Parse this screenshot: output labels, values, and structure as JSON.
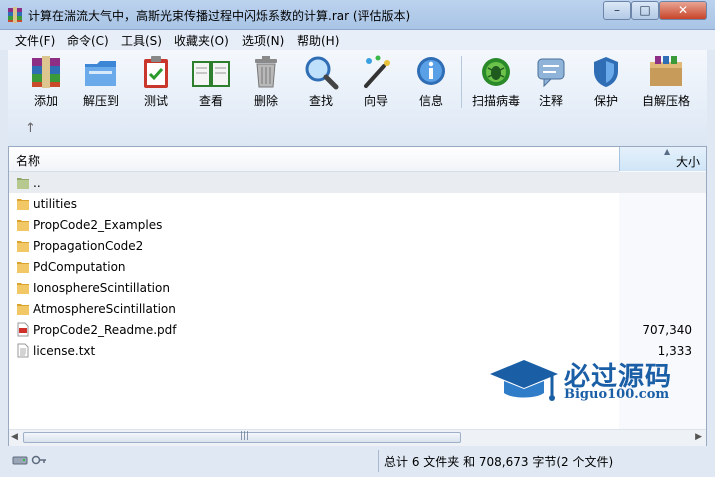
{
  "window": {
    "title": "计算在湍流大气中，高斯光束传播过程中闪烁系数的计算.rar (评估版本)",
    "min_glyph": "–",
    "max_glyph": "□",
    "close_glyph": "✕"
  },
  "menu": [
    "文件(F)",
    "命令(C)",
    "工具(S)",
    "收藏夹(O)",
    "选项(N)",
    "帮助(H)"
  ],
  "toolbar": {
    "buttons": [
      "添加",
      "解压到",
      "测试",
      "查看",
      "删除",
      "查找",
      "向导",
      "信息",
      "扫描病毒",
      "注释",
      "保护",
      "自解压格"
    ],
    "up_glyph": "↑"
  },
  "list": {
    "columns": {
      "name": "名称",
      "size": "大小"
    },
    "rows": [
      {
        "name": "..",
        "size": "",
        "type": "parent"
      },
      {
        "name": "utilities",
        "size": "",
        "type": "folder"
      },
      {
        "name": "PropCode2_Examples",
        "size": "",
        "type": "folder"
      },
      {
        "name": "PropagationCode2",
        "size": "",
        "type": "folder"
      },
      {
        "name": "PdComputation",
        "size": "",
        "type": "folder"
      },
      {
        "name": "IonosphereScintillation",
        "size": "",
        "type": "folder"
      },
      {
        "name": "AtmosphereScintillation",
        "size": "",
        "type": "folder"
      },
      {
        "name": "PropCode2_Readme.pdf",
        "size": "707,340",
        "type": "pdf"
      },
      {
        "name": "license.txt",
        "size": "1,333",
        "type": "txt"
      }
    ]
  },
  "scrollbar": {
    "left_glyph": "◀",
    "right_glyph": "▶",
    "grip_glyph": "|||"
  },
  "status": {
    "text": "总计 6 文件夹 和 708,673 字节(2 个文件)"
  },
  "watermark": {
    "main": "必过源码",
    "sub": "Biguo100.com"
  },
  "colors": {
    "folder": "#e8b84a",
    "accent": "#1a5ea6",
    "selected_row": "#e9edf2"
  }
}
